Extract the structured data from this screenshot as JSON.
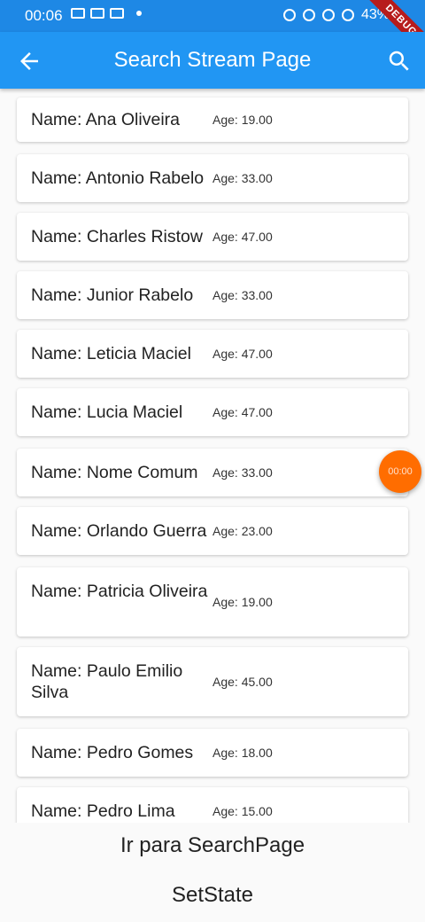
{
  "status_bar": {
    "time": "00:06",
    "battery": "43%"
  },
  "debug_banner": "DEBUG",
  "app_bar": {
    "title": "Search Stream Page",
    "back_icon": "arrow-back-icon",
    "search_icon": "search-icon"
  },
  "people": [
    {
      "name": "Name: Ana Oliveira",
      "age": "Age: 19.00"
    },
    {
      "name": "Name: Antonio Rabelo",
      "age": "Age: 33.00"
    },
    {
      "name": "Name: Charles Ristow",
      "age": "Age: 47.00"
    },
    {
      "name": "Name: Junior Rabelo",
      "age": "Age: 33.00"
    },
    {
      "name": "Name: Leticia Maciel",
      "age": "Age: 47.00"
    },
    {
      "name": "Name: Lucia Maciel",
      "age": "Age: 47.00"
    },
    {
      "name": "Name: Nome Comum",
      "age": "Age: 33.00"
    },
    {
      "name": "Name: Orlando Guerra",
      "age": "Age: 23.00"
    },
    {
      "name": "Name: Patricia Oliveira",
      "age": "Age: 19.00"
    },
    {
      "name": "Name: Paulo Emilio Silva",
      "age": "Age: 45.00"
    },
    {
      "name": "Name: Pedro Gomes",
      "age": "Age: 18.00"
    },
    {
      "name": "Name: Pedro Lima",
      "age": "Age: 15.00"
    }
  ],
  "fab": {
    "label": "00:00",
    "color": "#ff6d00"
  },
  "buttons": {
    "search_page": "Ir para SearchPage",
    "set_state": "SetState"
  },
  "colors": {
    "app_bar": "#2196f3",
    "status_bar": "#1e88e5"
  }
}
